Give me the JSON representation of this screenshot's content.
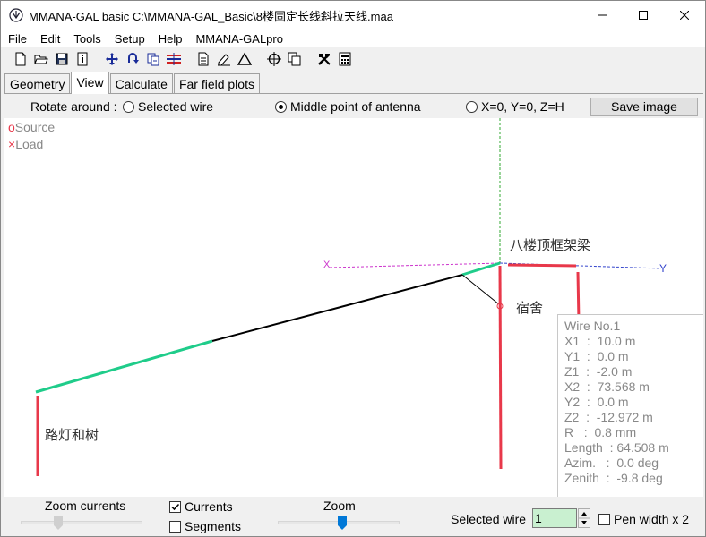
{
  "window": {
    "title": "MMANA-GAL basic C:\\MMANA-GAL_Basic\\8楼固定长线斜拉天线.maa",
    "minimize": "—",
    "maximize": "☐",
    "close": "✕"
  },
  "menu": [
    "File",
    "Edit",
    "Tools",
    "Setup",
    "Help",
    "MMANA-GALpro"
  ],
  "toolbar_icons": [
    "new-file-icon",
    "open-folder-icon",
    "save-disk-icon",
    "info-icon",
    "move-icon",
    "rotate-icon",
    "copy-icon",
    "align-icon",
    "document-icon",
    "edit-icon",
    "triangle-icon",
    "target-icon",
    "duplicate-icon",
    "tools-icon",
    "calculator-icon"
  ],
  "tabs": [
    "Geometry",
    "View",
    "Calculate",
    "Far field plots"
  ],
  "active_tab": "View",
  "rotate": {
    "label": "Rotate around :",
    "options": [
      "Selected wire",
      "Middle point of antenna",
      "X=0, Y=0, Z=H"
    ],
    "selected": "Middle point of antenna",
    "save_button": "Save image"
  },
  "legend": {
    "source": "Source",
    "load": "Load",
    "source_symbol": "o",
    "load_symbol": "×"
  },
  "axes": {
    "x_label": "X",
    "y_label": "Y"
  },
  "annotations": {
    "roof_beam": "八楼顶框架梁",
    "dorm": "宿舍",
    "street_light": "路灯和树"
  },
  "wire_info": {
    "title": "Wire No.1",
    "lines": [
      "X1  :  10.0 m",
      "Y1  :  0.0 m",
      "Z1  :  -2.0 m",
      "X2  :  73.568 m",
      "Y2  :  0.0 m",
      "Z2  :  -12.972 m",
      "R   :  0.8 mm",
      "Length  : 64.508 m",
      "Azim.   :  0.0 deg",
      "Zenith  :  -9.8 deg"
    ]
  },
  "bottom": {
    "zoom_currents_label": "Zoom currents",
    "currents_label": "Currents",
    "currents_checked": true,
    "segments_label": "Segments",
    "segments_checked": false,
    "zoom_label": "Zoom",
    "selected_wire_label": "Selected wire",
    "selected_wire_value": "1",
    "pen_width_label": "Pen width x 2",
    "pen_width_checked": false
  },
  "colors": {
    "current_green": "#1fcc8a",
    "wire_black": "#000000",
    "red_marker": "#e8384a",
    "axis_x": "#cc33cc",
    "axis_y": "#3344cc",
    "axis_z": "#33aa33",
    "selected_input_bg": "#c9f0d0"
  }
}
